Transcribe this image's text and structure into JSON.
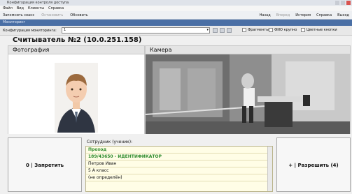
{
  "window": {
    "title": "Конфигурация контроля доступа"
  },
  "menu": [
    "Файл",
    "Вид",
    "Клиенты",
    "Справка"
  ],
  "toolbar": {
    "left": [
      "Запомнить сеанс",
      "Остановить",
      "Обновить"
    ],
    "right": [
      "Назад",
      "Вперед",
      "История",
      "Справка",
      "Выход"
    ]
  },
  "band": {
    "label": "Мониторинг"
  },
  "config": {
    "label": "Конфигурация мониторинга:",
    "value": "1",
    "checks": [
      "Фрагменты",
      "ФИО крупно",
      "Цветные кнопки"
    ]
  },
  "reader": {
    "title": "Считыватель №2 (10.0.251.158)"
  },
  "photo": {
    "header": "Фотография"
  },
  "camera": {
    "header": "Камера"
  },
  "buttons": {
    "deny": "0 | Запретить",
    "allow": "+ | Разрешить (4)"
  },
  "employee": {
    "label": "Сотрудник (ученик):",
    "event": "Проход",
    "code": "189/43650 - ИДЕНТИФИКАТОР",
    "name": "Петров Иван",
    "class": "5 А класс",
    "extra": "(не определён)"
  }
}
